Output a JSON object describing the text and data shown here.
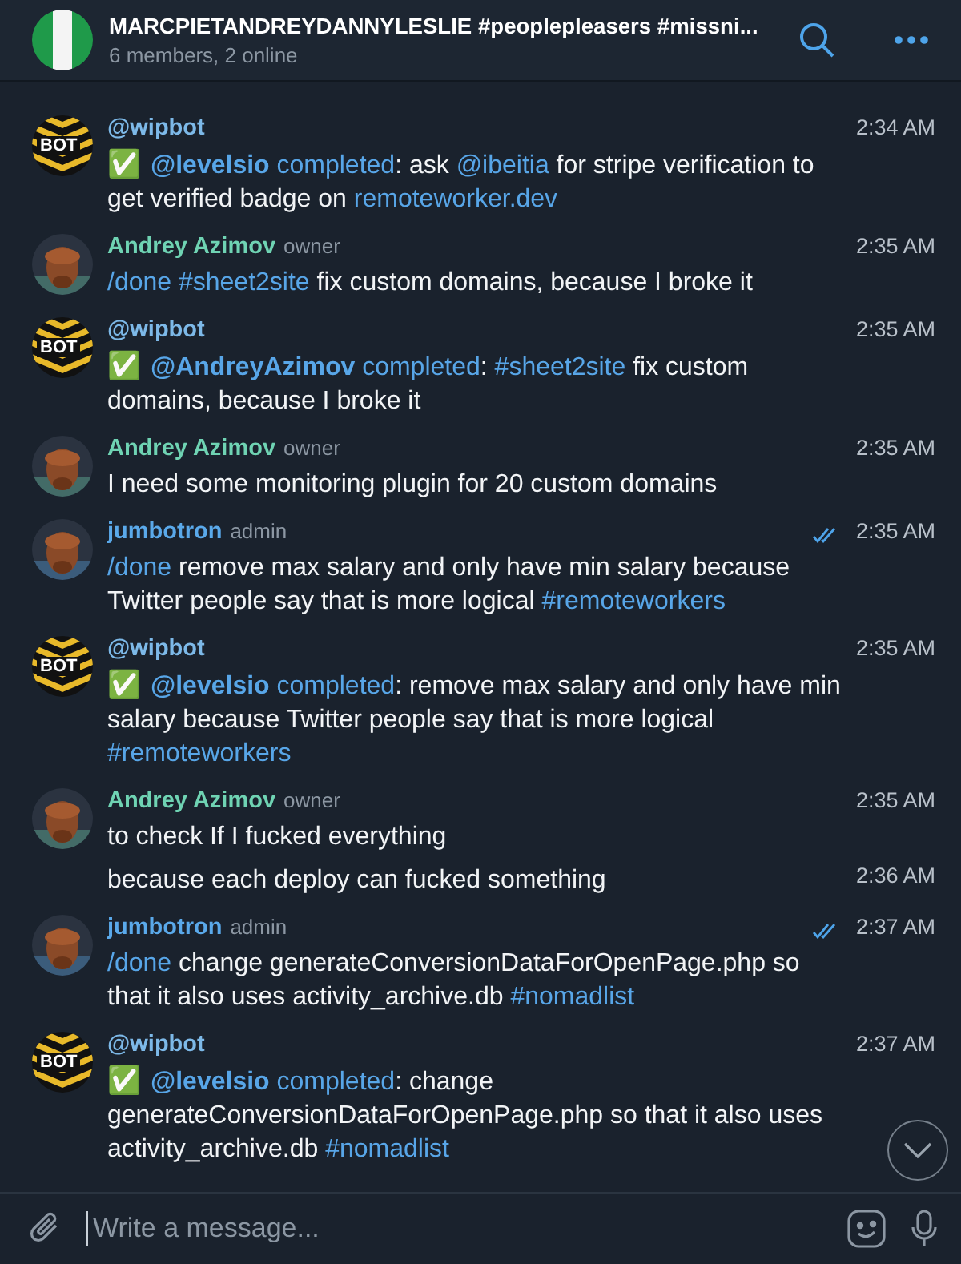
{
  "header": {
    "title": "MARCPIETANDREYDANNYLESLIE #peoplepleasers #missni...",
    "subtitle": "6 members, 2 online"
  },
  "messages": [
    {
      "kind": "bot",
      "avatar_label": "BOT",
      "sender": "@wipbot",
      "color": "#7db9e8",
      "time": "2:34 AM",
      "read": false,
      "parts": [
        {
          "kind": "emoji",
          "text": "✅"
        },
        {
          "kind": "mention",
          "text": "@levelsio"
        },
        {
          "kind": "link",
          "text": "completed"
        },
        {
          "kind": "plain",
          "text": ": ask "
        },
        {
          "kind": "link",
          "text": "@ibeitia"
        },
        {
          "kind": "plain",
          "text": " for stripe verification to get verified badge on "
        },
        {
          "kind": "link",
          "text": "remoteworker.dev"
        }
      ]
    },
    {
      "kind": "user",
      "sender": "Andrey Azimov",
      "role": "owner",
      "color": "#6fd3b3",
      "time": "2:35 AM",
      "read": false,
      "parts": [
        {
          "kind": "link",
          "text": "/done #sheet2site"
        },
        {
          "kind": "plain",
          "text": " fix custom domains, because I broke it"
        }
      ]
    },
    {
      "kind": "bot",
      "avatar_label": "BOT",
      "sender": "@wipbot",
      "color": "#7db9e8",
      "time": "2:35 AM",
      "read": false,
      "parts": [
        {
          "kind": "emoji",
          "text": "✅"
        },
        {
          "kind": "mention",
          "text": "@AndreyAzimov"
        },
        {
          "kind": "link",
          "text": "completed"
        },
        {
          "kind": "plain",
          "text": ": "
        },
        {
          "kind": "link",
          "text": "#sheet2site"
        },
        {
          "kind": "plain",
          "text": " fix custom domains, because I broke it"
        }
      ]
    },
    {
      "kind": "user",
      "sender": "Andrey Azimov",
      "role": "owner",
      "color": "#6fd3b3",
      "time": "2:35 AM",
      "read": false,
      "parts": [
        {
          "kind": "plain",
          "text": "I need some monitoring plugin for 20 custom domains"
        }
      ]
    },
    {
      "kind": "user",
      "sender": "jumbotron",
      "role": "admin",
      "color": "#5aa9ea",
      "time": "2:35 AM",
      "read": true,
      "parts": [
        {
          "kind": "link",
          "text": "/done"
        },
        {
          "kind": "plain",
          "text": " remove max salary and only have min salary because Twitter people say that is more logical "
        },
        {
          "kind": "link",
          "text": "#remoteworkers"
        }
      ]
    },
    {
      "kind": "bot",
      "avatar_label": "BOT",
      "sender": "@wipbot",
      "color": "#7db9e8",
      "time": "2:35 AM",
      "read": false,
      "parts": [
        {
          "kind": "emoji",
          "text": "✅"
        },
        {
          "kind": "mention",
          "text": "@levelsio"
        },
        {
          "kind": "link",
          "text": "completed"
        },
        {
          "kind": "plain",
          "text": ": remove max salary and only have min salary because Twitter people say that is more logical "
        },
        {
          "kind": "link",
          "text": "#remoteworkers"
        }
      ]
    },
    {
      "kind": "user",
      "sender": "Andrey Azimov",
      "role": "owner",
      "color": "#6fd3b3",
      "time": "2:35 AM",
      "read": false,
      "parts": [
        {
          "kind": "plain",
          "text": "to check If I fucked everything"
        }
      ]
    },
    {
      "kind": "continuation",
      "time": "2:36 AM",
      "read": false,
      "parts": [
        {
          "kind": "plain",
          "text": "because each deploy can fucked something"
        }
      ]
    },
    {
      "kind": "user",
      "sender": "jumbotron",
      "role": "admin",
      "color": "#5aa9ea",
      "time": "2:37 AM",
      "read": true,
      "parts": [
        {
          "kind": "link",
          "text": "/done"
        },
        {
          "kind": "plain",
          "text": " change generateConversionDataForOpenPage.php so that it also uses activity_archive.db "
        },
        {
          "kind": "link",
          "text": "#nomadlist"
        }
      ]
    },
    {
      "kind": "bot",
      "avatar_label": "BOT",
      "sender": "@wipbot",
      "color": "#7db9e8",
      "time": "2:37 AM",
      "read": false,
      "parts": [
        {
          "kind": "emoji",
          "text": "✅"
        },
        {
          "kind": "mention",
          "text": "@levelsio"
        },
        {
          "kind": "link",
          "text": "completed"
        },
        {
          "kind": "plain",
          "text": ": change generateConversionDataForOpenPage.php so that it also uses activity_archive.db "
        },
        {
          "kind": "link",
          "text": "#nomadlist"
        }
      ]
    }
  ],
  "composer": {
    "placeholder": "Write a message..."
  }
}
